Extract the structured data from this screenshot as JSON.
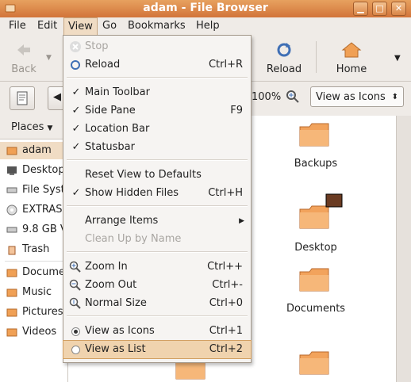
{
  "window": {
    "title": "adam - File Browser"
  },
  "menubar": [
    "File",
    "Edit",
    "View",
    "Go",
    "Bookmarks",
    "Help"
  ],
  "toolbar": {
    "back": "Back",
    "reload": "Reload",
    "home": "Home"
  },
  "locbar": {
    "zoom": "100%",
    "view_mode": "View as Icons"
  },
  "sidepane": {
    "header": "Places",
    "items": [
      "adam",
      "Desktop",
      "File System",
      "EXTRAS",
      "9.8 GB Volume",
      "Trash",
      "Documents",
      "Music",
      "Pictures",
      "Videos"
    ]
  },
  "files": [
    "Backups",
    "Desktop",
    "Documents"
  ],
  "view_menu": {
    "items": [
      {
        "label": "Stop",
        "accel": ""
      },
      {
        "label": "Reload",
        "accel": "Ctrl+R"
      },
      {
        "label": "Main Toolbar",
        "accel": ""
      },
      {
        "label": "Side Pane",
        "accel": "F9"
      },
      {
        "label": "Location Bar",
        "accel": ""
      },
      {
        "label": "Statusbar",
        "accel": ""
      },
      {
        "label": "Reset View to Defaults",
        "accel": ""
      },
      {
        "label": "Show Hidden Files",
        "accel": "Ctrl+H"
      },
      {
        "label": "Arrange Items",
        "accel": ""
      },
      {
        "label": "Clean Up by Name",
        "accel": ""
      },
      {
        "label": "Zoom In",
        "accel": "Ctrl++"
      },
      {
        "label": "Zoom Out",
        "accel": "Ctrl+-"
      },
      {
        "label": "Normal Size",
        "accel": "Ctrl+0"
      },
      {
        "label": "View as Icons",
        "accel": "Ctrl+1"
      },
      {
        "label": "View as List",
        "accel": "Ctrl+2"
      }
    ]
  },
  "colors": {
    "accent": "#d87f3e",
    "highlight": "#f0d3ae",
    "folder": "#f0a055"
  }
}
